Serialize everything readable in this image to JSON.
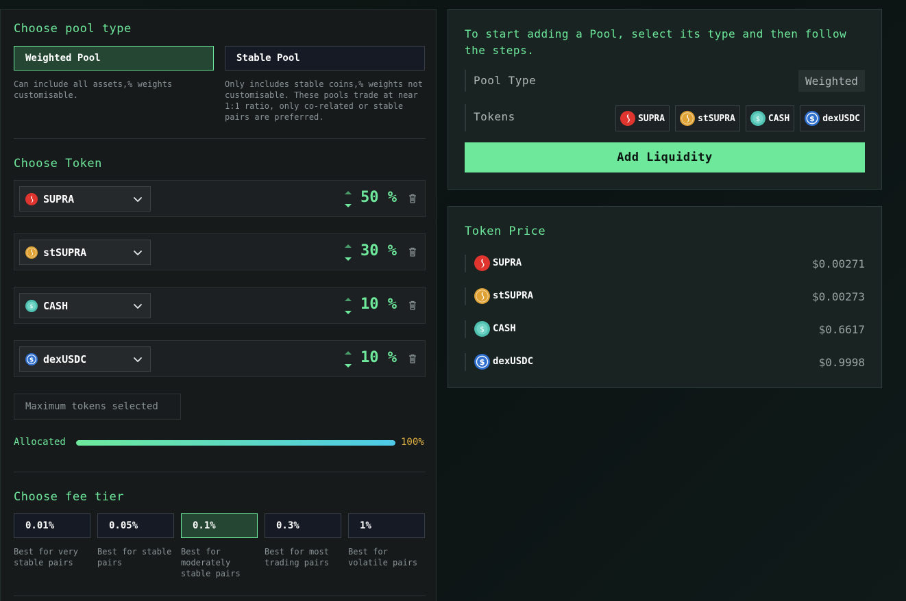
{
  "pool_type": {
    "title": "Choose pool type",
    "options": [
      {
        "label": "Weighted Pool",
        "desc": "Can include all assets,% weights customisable.",
        "active": true
      },
      {
        "label": "Stable Pool",
        "desc": "Only includes stable coins,% weights not customisable. These pools trade at near 1:1 ratio, only co-related or stable pairs are preferred.",
        "active": false
      }
    ]
  },
  "choose_token": {
    "title": "Choose Token",
    "tokens": [
      {
        "name": "SUPRA",
        "percent": "50 %",
        "icon": "supra-icon"
      },
      {
        "name": "stSUPRA",
        "percent": "30 %",
        "icon": "stsupra-icon"
      },
      {
        "name": "CASH",
        "percent": "10 %",
        "icon": "cash-icon"
      },
      {
        "name": "dexUSDC",
        "percent": "10 %",
        "icon": "dexusdc-icon"
      }
    ],
    "max_notice": "Maximum tokens selected"
  },
  "allocation": {
    "label": "Allocated",
    "value": "100%",
    "fraction": 1.0
  },
  "fee_tier": {
    "title": "Choose fee tier",
    "options": [
      {
        "label": "0.01%",
        "desc": "Best for very stable pairs",
        "active": false
      },
      {
        "label": "0.05%",
        "desc": "Best for stable pairs",
        "active": false
      },
      {
        "label": "0.1%",
        "desc": "Best for moderately stable pairs",
        "active": true
      },
      {
        "label": "0.3%",
        "desc": "Best for most trading pairs",
        "active": false
      },
      {
        "label": "1%",
        "desc": "Best for volatile pairs",
        "active": false
      }
    ]
  },
  "summary": {
    "intro": "To start adding a Pool, select its type and then follow the steps.",
    "pool_type_label": "Pool Type",
    "pool_type_value": "Weighted",
    "tokens_label": "Tokens",
    "tokens": [
      "SUPRA",
      "stSUPRA",
      "CASH",
      "dexUSDC"
    ],
    "add_liquidity": "Add Liquidity"
  },
  "token_price": {
    "title": "Token Price",
    "rows": [
      {
        "name": "SUPRA",
        "price": "$0.00271"
      },
      {
        "name": "stSUPRA",
        "price": "$0.00273"
      },
      {
        "name": "CASH",
        "price": "$0.6617"
      },
      {
        "name": "dexUSDC",
        "price": "$0.9998"
      }
    ]
  },
  "colors": {
    "accent": "#6ee99b",
    "supra": "#e0352f",
    "stsupra": "#e0a234",
    "cash": "#4fbfb0",
    "dexusdc": "#2f6fd0",
    "allocated_value": "#e3b341"
  }
}
